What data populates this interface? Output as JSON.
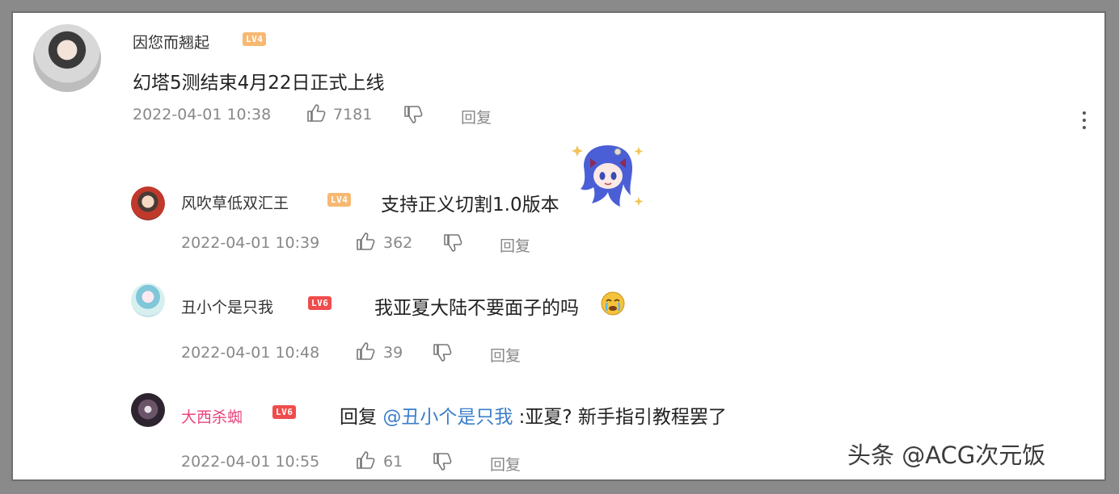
{
  "main_comment": {
    "username": "因您而翘起",
    "level": "LV4",
    "text": "幻塔5测结束4月22日正式上线",
    "timestamp": "2022-04-01 10:38",
    "likes": "7181",
    "reply_label": "回复"
  },
  "replies": [
    {
      "username": "风吹草低双汇王",
      "level": "LV4",
      "text": "支持正义切割1.0版本",
      "timestamp": "2022-04-01 10:39",
      "likes": "362",
      "reply_label": "回复"
    },
    {
      "username": "丑小个是只我",
      "level": "LV6",
      "text": "我亚夏大陆不要面子的吗",
      "timestamp": "2022-04-01 10:48",
      "likes": "39",
      "reply_label": "回复"
    },
    {
      "username": "大西杀蜘",
      "level": "LV6",
      "text_prefix": "回复",
      "mention": "@丑小个是只我",
      "text": ":亚夏? 新手指引教程罢了",
      "timestamp": "2022-04-01 10:55",
      "likes": "61",
      "reply_label": "回复"
    }
  ],
  "watermark": "头条 @ACG次元饭",
  "colors": {
    "lv4_badge": "#f7b872",
    "lv6_badge": "#f04c4c",
    "mention": "#3a7ec9",
    "vip_name": "#e8467c"
  },
  "icons": [
    "thumbs-up-icon",
    "thumbs-down-icon",
    "more-icon",
    "anime-sticker-icon",
    "cry-emoji-icon"
  ]
}
